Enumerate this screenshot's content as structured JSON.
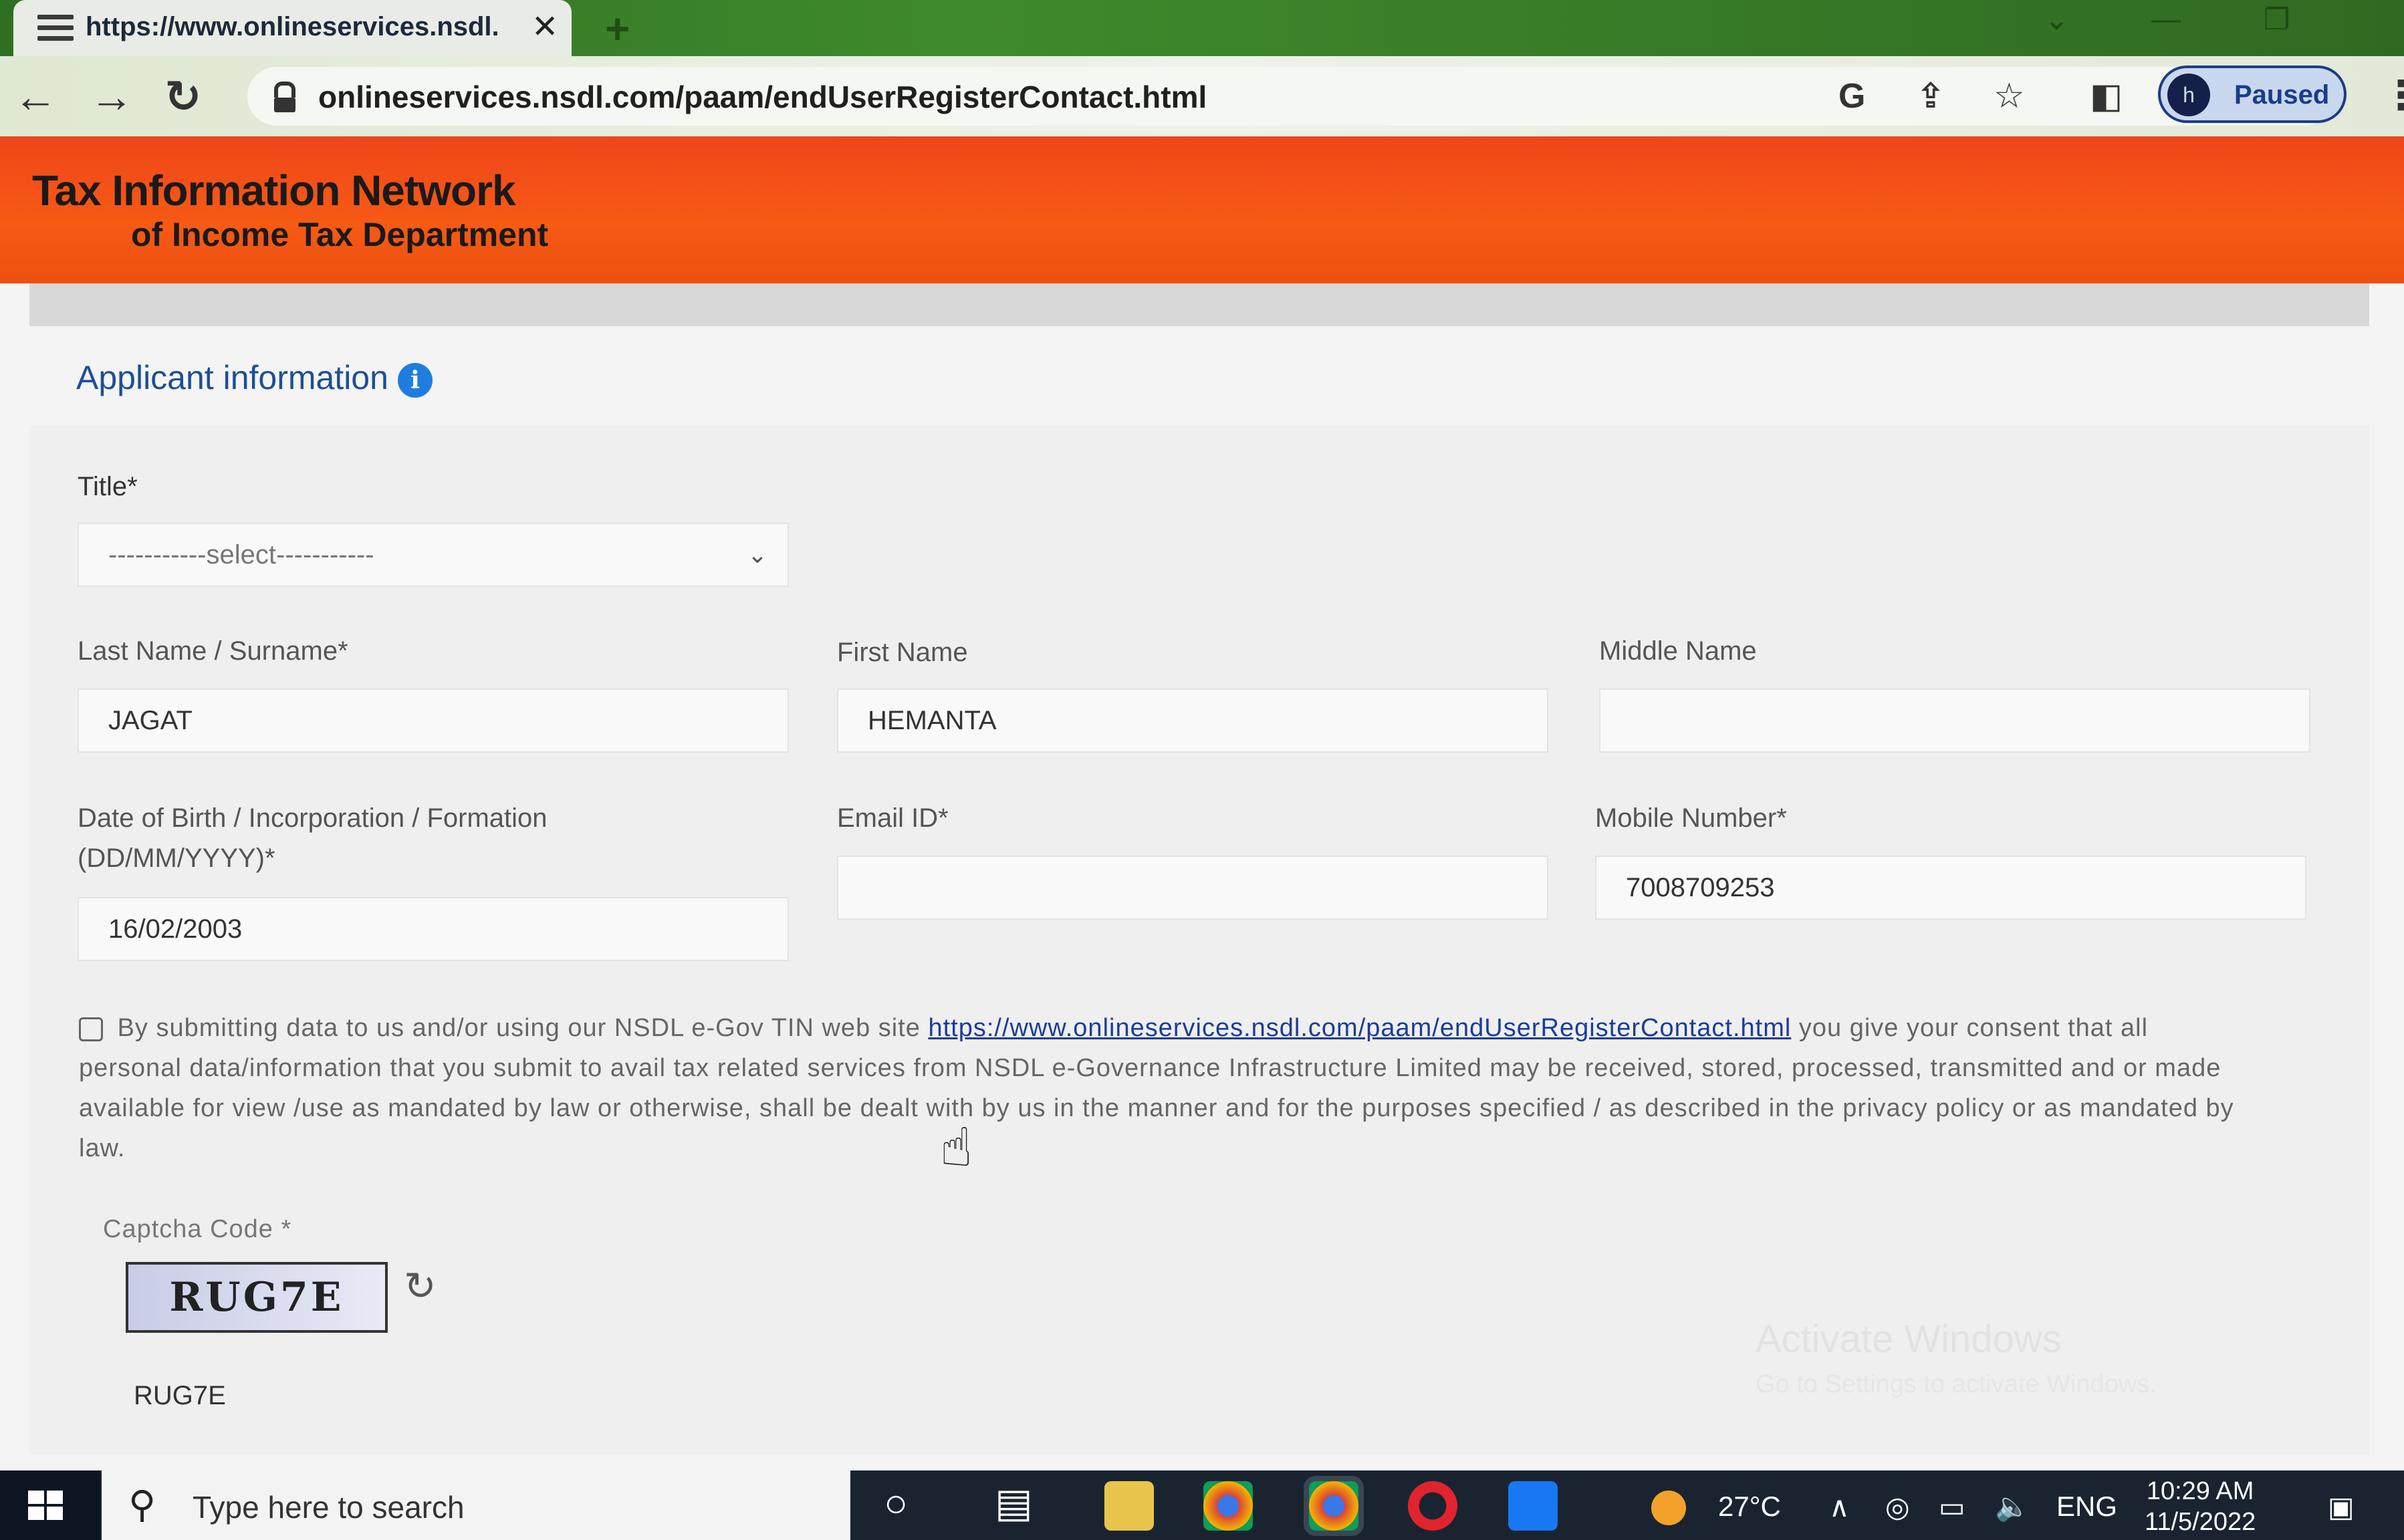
{
  "browser": {
    "tab_title": "https://www.onlineservices.nsdl.",
    "url": "onlineservices.nsdl.com/paam/endUserRegisterContact.html",
    "profile_initial": "h",
    "profile_status": "Paused"
  },
  "site": {
    "title": "Tax Information Network",
    "subtitle": "of Income Tax Department"
  },
  "form": {
    "section_title": "Applicant information",
    "title_label": "Title*",
    "title_value": "-----------select-----------",
    "last_name_label": "Last Name / Surname*",
    "last_name_value": "JAGAT",
    "first_name_label": "First Name",
    "first_name_value": "HEMANTA",
    "middle_name_label": "Middle Name",
    "middle_name_value": "",
    "dob_label_line1": "Date of Birth / Incorporation / Formation",
    "dob_label_line2": "(DD/MM/YYYY)*",
    "dob_value": "16/02/2003",
    "email_label": "Email ID*",
    "email_value": "",
    "mobile_label": "Mobile Number*",
    "mobile_value": "7008709253",
    "consent_before_link": "By submitting data to us and/or using our NSDL e-Gov TIN web site",
    "consent_link": "https://www.onlineservices.nsdl.com/paam/endUserRegisterContact.html",
    "consent_after_link": "you give your consent that all personal data/information that you submit to avail tax related services from NSDL e-Governance Infrastructure Limited may be received, stored, processed, transmitted and or made available for view /use as mandated by law or otherwise, shall be dealt with by us in the manner and for the purposes specified / as described in the privacy policy or as mandated by law.",
    "captcha_label": "Captcha Code *",
    "captcha_image_text": "RUG7E",
    "captcha_input_value": "RUG7E"
  },
  "watermark": {
    "title": "Activate Windows",
    "subtitle": "Go to Settings to activate Windows."
  },
  "taskbar": {
    "search_placeholder": "Type here to search",
    "temperature": "27°C",
    "language": "ENG",
    "time": "10:29 AM",
    "date": "11/5/2022"
  },
  "colors": {
    "header_orange": "#f4511a",
    "link_blue": "#1b3c9a",
    "section_blue": "#1d4f95",
    "info_icon_blue": "#1f7de0"
  }
}
